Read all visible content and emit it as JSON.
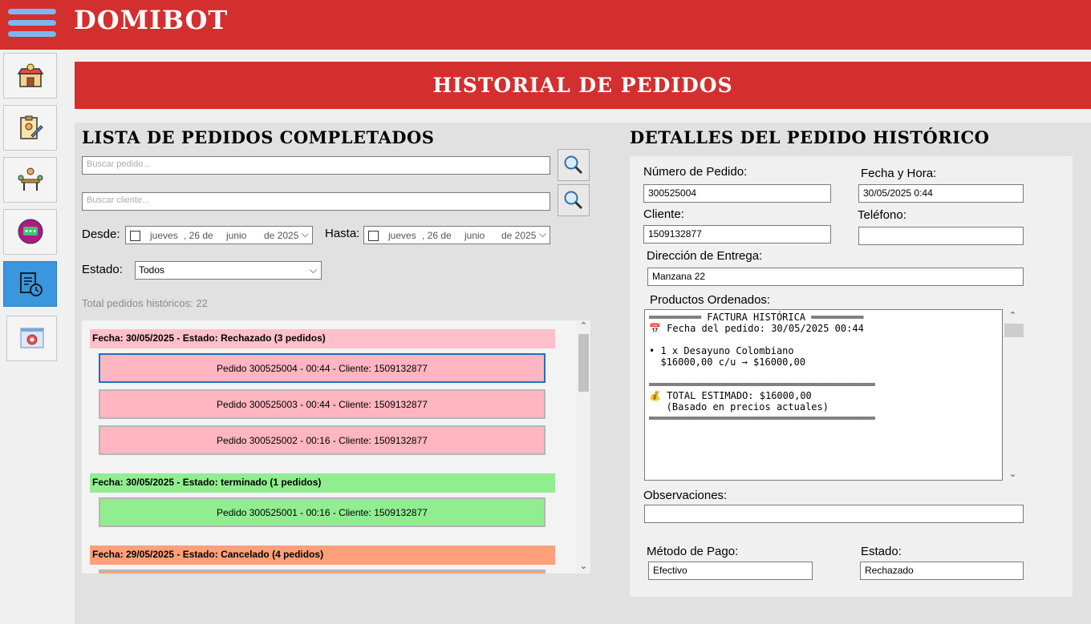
{
  "app": {
    "brand": "DOMIBOT"
  },
  "sidebar": {
    "items": [
      {
        "name": "store",
        "icon": "store-icon"
      },
      {
        "name": "orders-edit",
        "icon": "clipboard-user-icon"
      },
      {
        "name": "tables",
        "icon": "table-people-icon"
      },
      {
        "name": "messages",
        "icon": "chat-bubble-icon"
      },
      {
        "name": "history",
        "icon": "document-clock-icon",
        "active": true
      },
      {
        "name": "settings",
        "icon": "gear-window-icon"
      }
    ]
  },
  "page": {
    "banner": "HISTORIAL DE PEDIDOS"
  },
  "left": {
    "title": "LISTA DE PEDIDOS COMPLETADOS",
    "search_order_placeholder": "Buscar pedido...",
    "search_client_placeholder": "Buscar cliente...",
    "desde_label": "Desde:",
    "hasta_label": "Hasta:",
    "desde": {
      "day_name": "jueves",
      "day": ", 26 de",
      "month": "junio",
      "year": "de 2025"
    },
    "hasta": {
      "day_name": "jueves",
      "day": ", 26 de",
      "month": "junio",
      "year": "de 2025"
    },
    "estado_label": "Estado:",
    "estado_value": "Todos",
    "total_text": "Total pedidos históricos: 22",
    "groups": [
      {
        "header": "Fecha: 30/05/2025 - Estado: Rechazado (3 pedidos)",
        "color": "#ffc0cb",
        "orders": [
          "Pedido 300525004 - 00:44 - Cliente: 1509132877",
          "Pedido 300525003 - 00:44 - Cliente: 1509132877",
          "Pedido 300525002 - 00:16 - Cliente: 1509132877"
        ]
      },
      {
        "header": "Fecha: 30/05/2025 - Estado: terminado (1 pedidos)",
        "color": "#90ee90",
        "orders": [
          "Pedido 300525001 - 00:16 - Cliente: 1509132877"
        ]
      },
      {
        "header": "Fecha: 29/05/2025 - Estado: Cancelado (4 pedidos)",
        "color": "#ffa07a",
        "orders": []
      }
    ]
  },
  "right": {
    "title": "DETALLES DEL PEDIDO HISTÓRICO",
    "numero_label": "Número de Pedido:",
    "numero_value": "300525004",
    "fecha_label": "Fecha y Hora:",
    "fecha_value": "30/05/2025 0:44",
    "cliente_label": "Cliente:",
    "cliente_value": "1509132877",
    "telefono_label": "Teléfono:",
    "telefono_value": "",
    "direccion_label": "Dirección de Entrega:",
    "direccion_value": "Manzana 22",
    "productos_label": "Productos Ordenados:",
    "invoice_text": "═════════ FACTURA HISTÓRICA ═════════\n📅 Fecha del pedido: 30/05/2025 00:44\n\n• 1 x Desayuno Colombiano\n  $16000,00 c/u → $16000,00\n\n═══════════════════════════════════════\n💰 TOTAL ESTIMADO: $16000,00\n   (Basado en precios actuales)\n═══════════════════════════════════════",
    "observaciones_label": "Observaciones:",
    "observaciones_value": "",
    "metodo_label": "Método de Pago:",
    "metodo_value": "Efectivo",
    "estado_label": "Estado:",
    "estado_value": "Rechazado"
  }
}
